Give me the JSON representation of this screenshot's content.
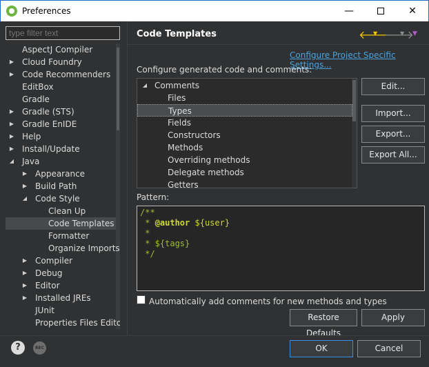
{
  "window": {
    "title": "Preferences",
    "minimize": "—",
    "close": "✕"
  },
  "filter": {
    "placeholder": "type filter text"
  },
  "left_tree": [
    {
      "label": "AspectJ Compiler",
      "indent": 0,
      "arrow": ""
    },
    {
      "label": "Cloud Foundry",
      "indent": 0,
      "arrow": "▶"
    },
    {
      "label": "Code Recommenders",
      "indent": 0,
      "arrow": "▶"
    },
    {
      "label": "EditBox",
      "indent": 0,
      "arrow": ""
    },
    {
      "label": "Gradle",
      "indent": 0,
      "arrow": ""
    },
    {
      "label": "Gradle (STS)",
      "indent": 0,
      "arrow": "▶"
    },
    {
      "label": "Gradle EnIDE",
      "indent": 0,
      "arrow": "▶"
    },
    {
      "label": "Help",
      "indent": 0,
      "arrow": "▶"
    },
    {
      "label": "Install/Update",
      "indent": 0,
      "arrow": "▶"
    },
    {
      "label": "Java",
      "indent": 0,
      "arrow": "◢"
    },
    {
      "label": "Appearance",
      "indent": 1,
      "arrow": "▶"
    },
    {
      "label": "Build Path",
      "indent": 1,
      "arrow": "▶"
    },
    {
      "label": "Code Style",
      "indent": 1,
      "arrow": "◢"
    },
    {
      "label": "Clean Up",
      "indent": 2,
      "arrow": ""
    },
    {
      "label": "Code Templates",
      "indent": 2,
      "arrow": "",
      "selected": true
    },
    {
      "label": "Formatter",
      "indent": 2,
      "arrow": ""
    },
    {
      "label": "Organize Imports",
      "indent": 2,
      "arrow": ""
    },
    {
      "label": "Compiler",
      "indent": 1,
      "arrow": "▶"
    },
    {
      "label": "Debug",
      "indent": 1,
      "arrow": "▶"
    },
    {
      "label": "Editor",
      "indent": 1,
      "arrow": "▶"
    },
    {
      "label": "Installed JREs",
      "indent": 1,
      "arrow": "▶"
    },
    {
      "label": "JUnit",
      "indent": 1,
      "arrow": ""
    },
    {
      "label": "Properties Files Editor",
      "indent": 1,
      "arrow": ""
    }
  ],
  "page": {
    "title": "Code Templates",
    "link": "Configure Project Specific Settings...",
    "configure_label": "Configure generated code and comments:"
  },
  "templates_tree": [
    {
      "label": "Comments",
      "indent": 0,
      "arrow": "◢"
    },
    {
      "label": "Files",
      "indent": 1,
      "arrow": ""
    },
    {
      "label": "Types",
      "indent": 1,
      "arrow": "",
      "selected": true
    },
    {
      "label": "Fields",
      "indent": 1,
      "arrow": ""
    },
    {
      "label": "Constructors",
      "indent": 1,
      "arrow": ""
    },
    {
      "label": "Methods",
      "indent": 1,
      "arrow": ""
    },
    {
      "label": "Overriding methods",
      "indent": 1,
      "arrow": ""
    },
    {
      "label": "Delegate methods",
      "indent": 1,
      "arrow": ""
    },
    {
      "label": "Getters",
      "indent": 1,
      "arrow": ""
    }
  ],
  "buttons": {
    "edit": "Edit...",
    "import": "Import...",
    "export": "Export...",
    "export_all": "Export All...",
    "restore_defaults": "Restore Defaults",
    "apply": "Apply",
    "ok": "OK",
    "cancel": "Cancel"
  },
  "pattern": {
    "label": "Pattern:",
    "lines": [
      {
        "pre": "/**",
        "tag": "",
        "post": ""
      },
      {
        "pre": " * ",
        "tag": "@author",
        "post": " ${user}"
      },
      {
        "pre": " *",
        "tag": "",
        "post": ""
      },
      {
        "pre": " * ${tags}",
        "tag": "",
        "post": ""
      },
      {
        "pre": " */",
        "tag": "",
        "post": ""
      }
    ]
  },
  "auto_comments": {
    "label": "Automatically add comments for new methods and types",
    "checked": false
  },
  "footer": {
    "help_icon": "?",
    "rec_icon": "REC"
  },
  "colors": {
    "background": "#2f3132",
    "link": "#4aa3df",
    "nav_back": "#f6c800",
    "pattern_text": "#9fbf32",
    "ok_border": "#3c8be2"
  }
}
